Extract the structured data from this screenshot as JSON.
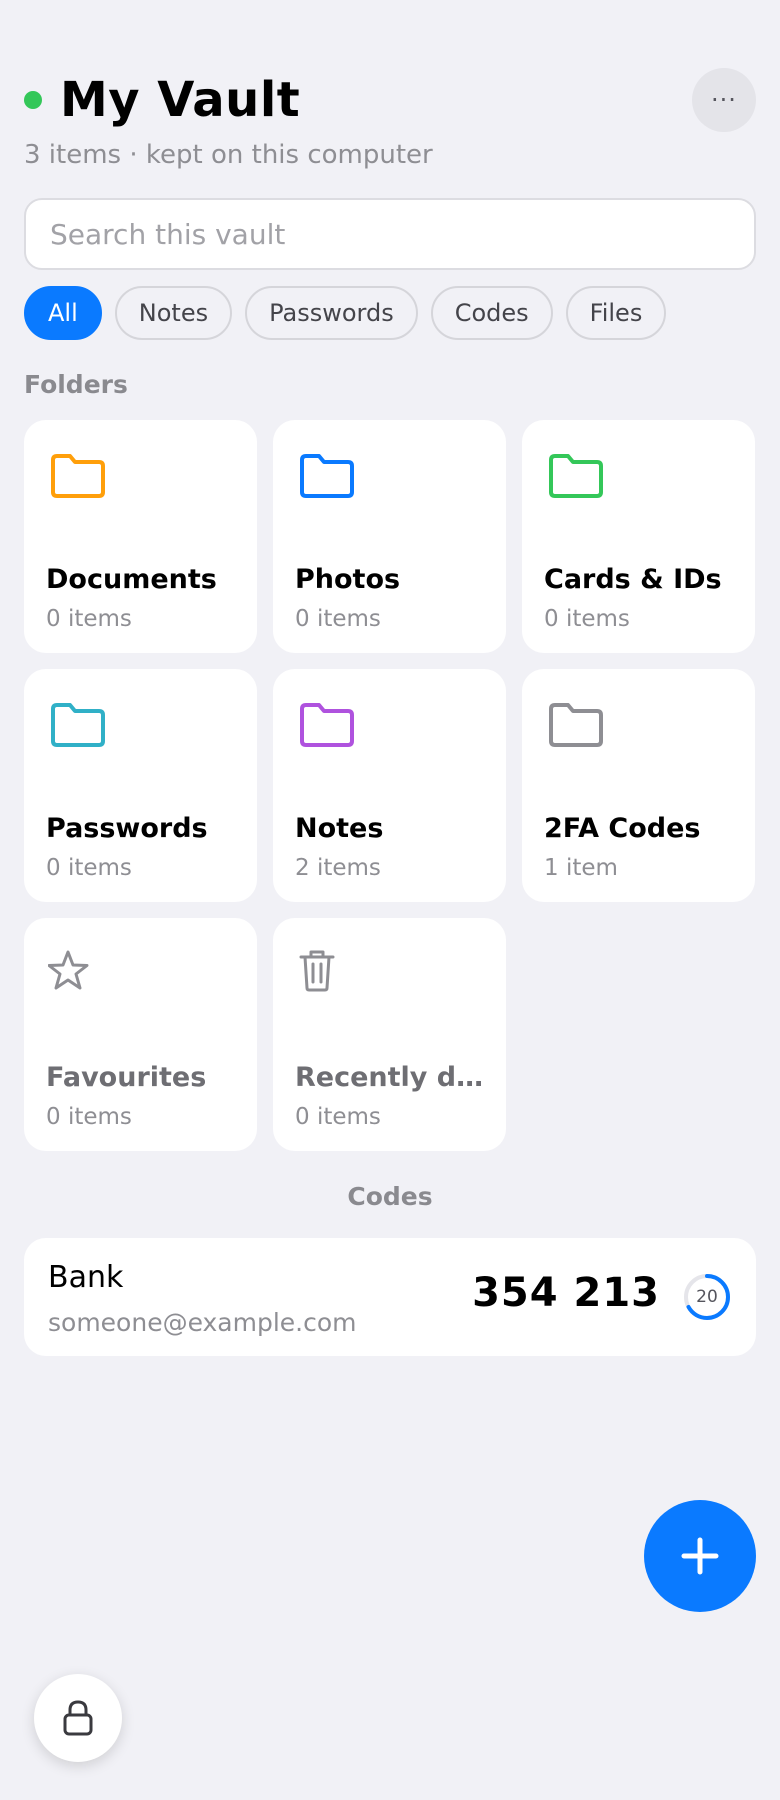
{
  "header": {
    "title": "My Vault",
    "subtitle": "3 items · kept on this computer",
    "status_color": "#34c759",
    "more_icon": "ellipsis-icon",
    "more_label": "···"
  },
  "search": {
    "placeholder": "Search this vault",
    "value": ""
  },
  "filters": [
    {
      "label": "All",
      "active": true
    },
    {
      "label": "Notes",
      "active": false
    },
    {
      "label": "Passwords",
      "active": false
    },
    {
      "label": "Codes",
      "active": false
    },
    {
      "label": "Files",
      "active": false
    }
  ],
  "folders_label": "Folders",
  "folders": [
    {
      "name": "Documents",
      "count": "0 items",
      "icon": "folder-icon",
      "color": "#ff9f0a"
    },
    {
      "name": "Photos",
      "count": "0 items",
      "icon": "folder-icon",
      "color": "#0a7aff"
    },
    {
      "name": "Cards & IDs",
      "count": "0 items",
      "icon": "folder-icon",
      "color": "#34c759"
    },
    {
      "name": "Passwords",
      "count": "0 items",
      "icon": "folder-icon",
      "color": "#30b0c7"
    },
    {
      "name": "Notes",
      "count": "2 items",
      "icon": "folder-icon",
      "color": "#af52de"
    },
    {
      "name": "2FA Codes",
      "count": "1 item",
      "icon": "folder-icon",
      "color": "#8e8e93"
    },
    {
      "name": "Favourites",
      "count": "0 items",
      "icon": "star-icon",
      "color": "#8e8e93"
    },
    {
      "name": "Recently deleted",
      "count": "0 items",
      "icon": "trash-icon",
      "color": "#8e8e93"
    }
  ],
  "codes_label": "Codes",
  "codes": [
    {
      "issuer": "Bank",
      "account": "someone@example.com",
      "code": "354 213",
      "seconds_left": "20",
      "fraction_remaining": 0.67
    }
  ],
  "accent_color": "#0a7aff",
  "fab_icon": "plus-icon",
  "lock_icon": "lock-icon"
}
